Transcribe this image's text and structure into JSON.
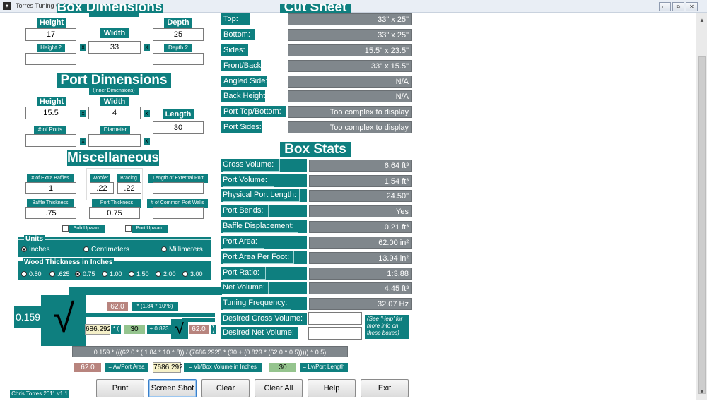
{
  "window": {
    "title": "Torres Tuning Calculator",
    "minimize": "▭",
    "restore": "⧉",
    "close": "✕",
    "app_icon": "app-icon"
  },
  "box": {
    "section_title": "Box Dimensions",
    "height_label": "Height",
    "depth_label": "Depth",
    "width_label": "Width",
    "height_value": "17",
    "depth_value": "25",
    "width_value": "33",
    "height2_label": "Height 2",
    "depth2_label": "Depth 2",
    "height2_value": "",
    "depth2_value": ""
  },
  "port": {
    "section_title": "Port Dimensions",
    "subtitle": "(Inner Dimensions)",
    "height_label": "Height",
    "width_label": "Width",
    "length_label": "Length",
    "height_value": "15.5",
    "width_value": "4",
    "length_value": "30",
    "ports_label": "# of Ports",
    "diameter_label": "Diameter",
    "ports_value": "",
    "diameter_value": ""
  },
  "misc": {
    "section_title": "Miscellaneous",
    "extra_baffles_label": "# of Extra Baffles",
    "extra_baffles_value": "1",
    "woofer_label": "Woofer",
    "bracing_label": "Bracing",
    "woofer_value": ".22",
    "bracing_value": ".22",
    "ext_port_label": "Length of External Port",
    "ext_port_value": "",
    "baffle_thickness_label": "Baffle Thickness",
    "baffle_thickness_value": ".75",
    "port_thickness_label": "Port Thickness",
    "port_thickness_value": "0.75",
    "common_walls_label": "# of Common Port Walls",
    "common_walls_value": "",
    "sub_upward": "Sub Upward",
    "port_upward": "Port Upward"
  },
  "units": {
    "legend": "Units",
    "options": [
      "Inches",
      "Centimeters",
      "Millimeters"
    ],
    "selected": "Inches"
  },
  "wood": {
    "legend": "Wood Thickness in Inches",
    "options": [
      "0.50",
      ".625",
      "0.75",
      "1.00",
      "1.50",
      "2.00",
      "3.00"
    ],
    "selected": "0.75"
  },
  "cut_sheet": {
    "section_title": "Cut Sheet",
    "rows": [
      {
        "label": "Top:",
        "value": "33\" x 25\""
      },
      {
        "label": "Bottom:",
        "value": "33\" x 25\""
      },
      {
        "label": "Sides:",
        "value": "15.5\" x 23.5\""
      },
      {
        "label": "Front/Back:",
        "value": "33\" x 15.5\""
      },
      {
        "label": "Angled Side:",
        "value": "N/A"
      },
      {
        "label": "Back Height:",
        "value": "N/A"
      },
      {
        "label": "Port Top/Bottom:",
        "value": "Too complex to display"
      },
      {
        "label": "Port Sides:",
        "value": "Too complex to display"
      }
    ]
  },
  "box_stats": {
    "section_title": "Box Stats",
    "rows": [
      {
        "label": "Gross Volume:",
        "value": "6.64 ft³"
      },
      {
        "label": "Port Volume:",
        "value": "1.54 ft³"
      },
      {
        "label": "Physical Port Length:",
        "value": "24.50\""
      },
      {
        "label": "Port Bends:",
        "value": "Yes"
      },
      {
        "label": "Baffle Displacement:",
        "value": "0.21 ft³"
      },
      {
        "label": "Port Area:",
        "value": "62.00 in²"
      },
      {
        "label": "Port Area Per Foot:",
        "value": "13.94 in²"
      },
      {
        "label": "Port Ratio:",
        "value": "1:3.88"
      },
      {
        "label": "Net Volume:",
        "value": "4.45 ft³"
      },
      {
        "label": "Tuning Frequency:",
        "value": "32.07 Hz"
      }
    ],
    "desired_gross_label": "Desired Gross Volume:",
    "desired_net_label": "Desired Net Volume:",
    "desired_gross_value": "",
    "desired_net_value": "",
    "help_note": "(See 'Help' for more info on these boxes)"
  },
  "formula": {
    "coef": "0.159",
    "area": "62.0",
    "const": "* (1.84 * 10^8)",
    "vb": "686.292",
    "op_mult": "* (",
    "lv": "30",
    "plus": "+ 0.823",
    "area2": "62.0",
    "close_paren": ")",
    "full_text": "0.159 * (((62.0 * ( 1.84 * 10 ^ 8)) / (7686.2925 * (30 + (0.823 * (62.0 ^ 0.5))))) ^ 0.5)",
    "legend_area": "62.0",
    "legend_area_label": "= Av/Port Area",
    "legend_vb": "7686.292",
    "legend_vb_label": "= Vb/Box Volume in Inches",
    "legend_lv": "30",
    "legend_lv_label": "= Lv/Port Length",
    "sqrt": "√"
  },
  "buttons": {
    "print": "Print",
    "screen_shot": "Screen Shot",
    "clear": "Clear",
    "clear_all": "Clear All",
    "help": "Help",
    "exit": "Exit"
  },
  "footer": {
    "credit": "Chris Torres 2011 v1.1"
  },
  "colors": {
    "teal": "#0e7f7f",
    "gray": "#80878c"
  }
}
